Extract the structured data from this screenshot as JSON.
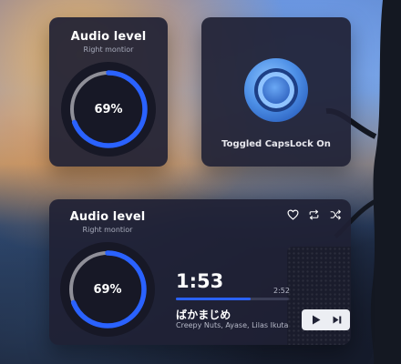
{
  "widget_audio_top": {
    "title": "Audio level",
    "subtitle": "Right montior",
    "level_percent": 69,
    "level_label": "69%"
  },
  "widget_capslock": {
    "message": "Toggled CapsLock On"
  },
  "widget_player": {
    "title": "Audio level",
    "subtitle": "Right montior",
    "level_percent": 69,
    "level_label": "69%",
    "current_time": "1:53",
    "total_time": "2:52",
    "progress_fraction": 0.66,
    "song_title": "ばかまじめ",
    "artists": "Creepy Nuts, Ayase, Lilas Ikuta",
    "icons": {
      "like": "heart-icon",
      "repeat": "repeat-icon",
      "shuffle": "shuffle-icon",
      "play": "play-icon",
      "next": "next-track-icon"
    }
  },
  "colors": {
    "accent": "#2a62ff",
    "card_bg": "#1f2134",
    "track": "#9a9aa2"
  }
}
